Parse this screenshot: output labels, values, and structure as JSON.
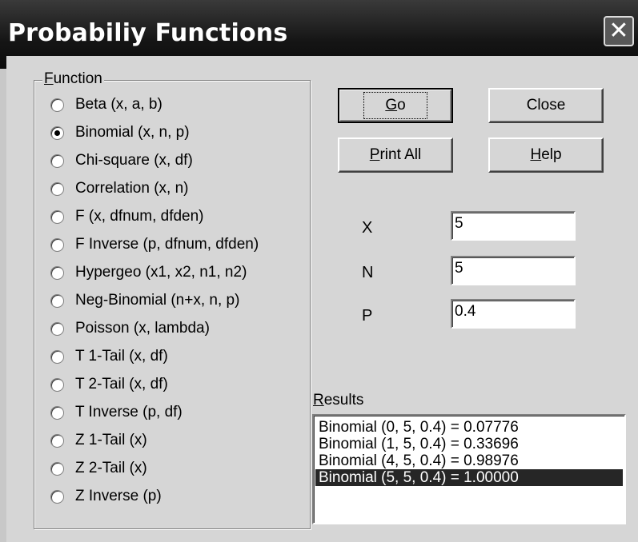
{
  "window": {
    "title": "Probabiliy Functions",
    "close_glyph": "✕"
  },
  "function_group": {
    "legend_prefix": "F",
    "legend_rest": "unction",
    "options": [
      {
        "label": "Beta (x, a, b)",
        "checked": false
      },
      {
        "label": "Binomial (x, n, p)",
        "checked": true
      },
      {
        "label": "Chi-square (x, df)",
        "checked": false
      },
      {
        "label": "Correlation (x, n)",
        "checked": false
      },
      {
        "label": "F (x, dfnum, dfden)",
        "checked": false
      },
      {
        "label": "F Inverse (p, dfnum, dfden)",
        "checked": false
      },
      {
        "label": "Hypergeo (x1, x2, n1, n2)",
        "checked": false
      },
      {
        "label": "Neg-Binomial (n+x, n, p)",
        "checked": false
      },
      {
        "label": "Poisson (x, lambda)",
        "checked": false
      },
      {
        "label": "T 1-Tail (x, df)",
        "checked": false
      },
      {
        "label": "T 2-Tail (x, df)",
        "checked": false
      },
      {
        "label": "T Inverse (p, df)",
        "checked": false
      },
      {
        "label": "Z 1-Tail (x)",
        "checked": false
      },
      {
        "label": "Z 2-Tail (x)",
        "checked": false
      },
      {
        "label": "Z Inverse (p)",
        "checked": false
      }
    ]
  },
  "buttons": {
    "go": {
      "mnemonic": "G",
      "rest": "o"
    },
    "close": {
      "label": "Close"
    },
    "print_all": {
      "mnemonic": "P",
      "rest": "rint All"
    },
    "help": {
      "mnemonic": "H",
      "rest": "elp"
    }
  },
  "params": {
    "x": {
      "label": "X",
      "value": "5"
    },
    "n": {
      "label": "N",
      "value": "5"
    },
    "p": {
      "label": "P",
      "value": "0.4"
    }
  },
  "results": {
    "label_prefix": "R",
    "label_rest": "esults",
    "items": [
      "Binomial (0, 5, 0.4) = 0.07776",
      "Binomial (1, 5, 0.4) = 0.33696",
      "Binomial (4, 5, 0.4) = 0.98976",
      "Binomial (5, 5, 0.4) = 1.00000"
    ],
    "selected_index": 3
  },
  "colors": {
    "selection": "#262626",
    "titlebar": "#151515",
    "dialog_face": "#d6d6d6"
  }
}
